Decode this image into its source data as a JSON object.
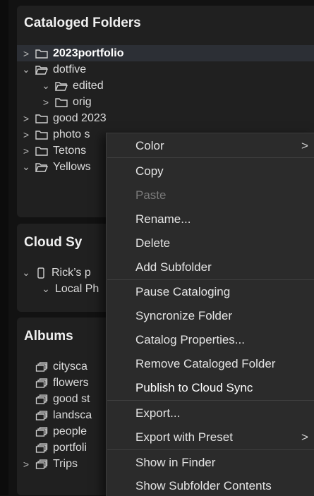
{
  "catalog": {
    "title": "Cataloged Folders",
    "items": [
      {
        "label": "2023portfolio"
      },
      {
        "label": "dotfive"
      },
      {
        "label": "edited"
      },
      {
        "label": "orig"
      },
      {
        "label": "good 2023"
      },
      {
        "label": "photo s"
      },
      {
        "label": "Tetons"
      },
      {
        "label": "Yellows"
      }
    ]
  },
  "cloud": {
    "title": "Cloud Sy",
    "items": [
      {
        "label": "Rick’s p"
      },
      {
        "label": "Local Ph"
      }
    ]
  },
  "albums": {
    "title": "Albums",
    "items": [
      {
        "label": "citysca"
      },
      {
        "label": "flowers"
      },
      {
        "label": "good st"
      },
      {
        "label": "landsca"
      },
      {
        "label": "people"
      },
      {
        "label": "portfoli"
      },
      {
        "label": "Trips"
      }
    ]
  },
  "context_menu": {
    "items": [
      {
        "label": "Color",
        "submenu": true
      },
      {
        "label": "Copy"
      },
      {
        "label": "Paste",
        "disabled": true
      },
      {
        "label": "Rename..."
      },
      {
        "label": "Delete"
      },
      {
        "label": "Add Subfolder"
      },
      {
        "label": "Pause Cataloging"
      },
      {
        "label": "Syncronize Folder"
      },
      {
        "label": "Catalog Properties..."
      },
      {
        "label": "Remove Cataloged Folder"
      },
      {
        "label": "Publish to Cloud Sync"
      },
      {
        "label": "Export..."
      },
      {
        "label": "Export with Preset",
        "submenu": true
      },
      {
        "label": "Show in Finder"
      },
      {
        "label": "Show Subfolder Contents"
      }
    ],
    "submenu_arrow": ">"
  },
  "glyphs": {
    "chevron_right": ">",
    "chevron_down": "⌄"
  }
}
